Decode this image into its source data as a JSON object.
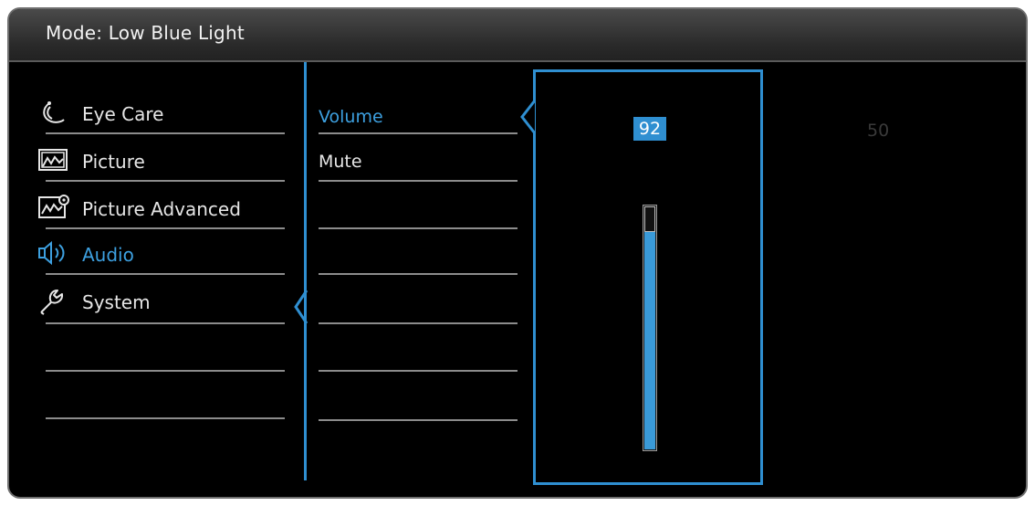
{
  "header": {
    "title": "Mode: Low Blue Light"
  },
  "menu": {
    "items": [
      {
        "label": "Eye Care",
        "icon": "eye-care-icon"
      },
      {
        "label": "Picture",
        "icon": "picture-icon"
      },
      {
        "label": "Picture Advanced",
        "icon": "picture-advanced-icon"
      },
      {
        "label": "Audio",
        "icon": "audio-icon",
        "selected": true
      },
      {
        "label": "System",
        "icon": "system-wrench-icon"
      }
    ]
  },
  "submenu": {
    "items": [
      {
        "label": "Volume",
        "selected": true
      },
      {
        "label": "Mute"
      }
    ]
  },
  "volume": {
    "value": "92",
    "level_percent": 92,
    "ghost_value": "50"
  },
  "colors": {
    "accent": "#2f8fd1",
    "text": "#e6e6e6",
    "background": "#000000",
    "header": "#3a3a3a"
  }
}
